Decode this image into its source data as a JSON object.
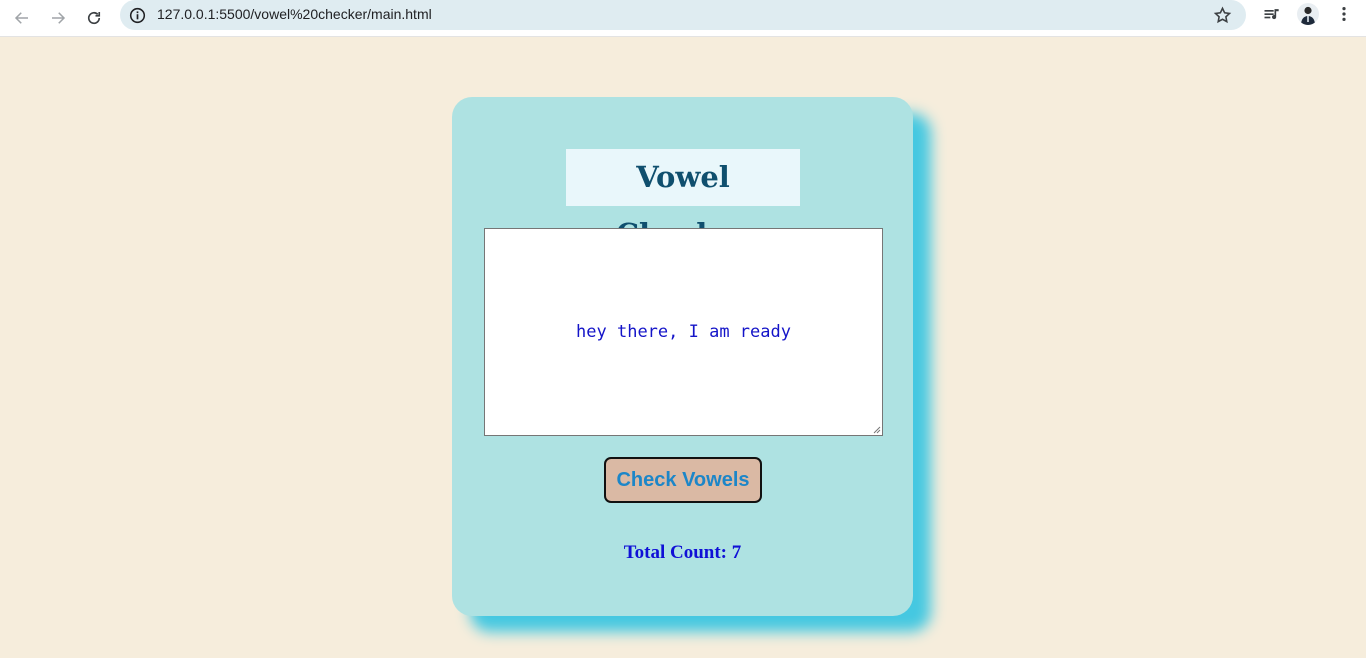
{
  "browser": {
    "url": "127.0.0.1:5500/vowel%20checker/main.html",
    "icons": [
      "back-arrow-icon",
      "forward-arrow-icon",
      "reload-icon",
      "site-info-icon",
      "bookmark-star-icon",
      "media-control-icon",
      "profile-avatar",
      "kebab-menu-icon"
    ]
  },
  "app": {
    "title": "Vowel Checker",
    "input_text": "hey there, I am ready",
    "button_label": "Check Vowels",
    "result_label": "Total Count: 7"
  },
  "colors": {
    "page_background": "#f6eddc",
    "card_background": "#aee2e2",
    "card_shadow": "#45c8e1",
    "title_color": "#0f4f6e",
    "title_background": "#e9f7fb",
    "input_text_color": "#1414c8",
    "button_background": "#dab9a4",
    "button_text_color": "#1c86c8",
    "result_color": "#1010d6"
  }
}
